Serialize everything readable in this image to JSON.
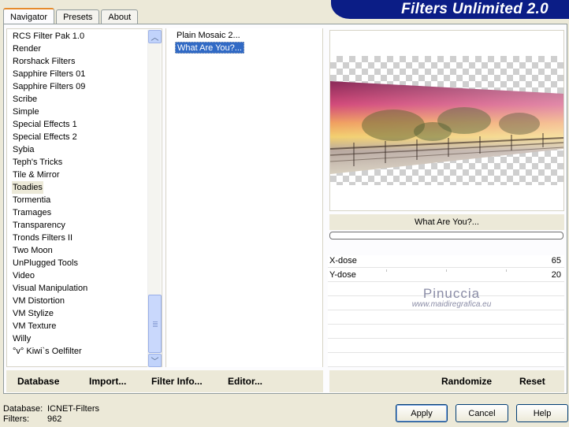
{
  "tabs": [
    "Navigator",
    "Presets",
    "About"
  ],
  "title": "Filters Unlimited 2.0",
  "categories": [
    "RCS Filter Pak 1.0",
    "Render",
    "Rorshack Filters",
    "Sapphire Filters 01",
    "Sapphire Filters 09",
    "Scribe",
    "Simple",
    "Special Effects 1",
    "Special Effects 2",
    "Sybia",
    "Teph's Tricks",
    "Tile & Mirror",
    "Toadies",
    "Tormentia",
    "Tramages",
    "Transparency",
    "Tronds Filters II",
    "Two Moon",
    "UnPlugged Tools",
    "Video",
    "Visual Manipulation",
    "VM Distortion",
    "VM Stylize",
    "VM Texture",
    "Willy",
    "°v° Kiwi`s Oelfilter"
  ],
  "selected_category": "Toadies",
  "filters": [
    "Plain Mosaic 2...",
    "What Are You?..."
  ],
  "selected_filter": "What Are You?...",
  "filter_name": "What Are You?...",
  "params": [
    {
      "label": "X-dose",
      "value": "65"
    },
    {
      "label": "Y-dose",
      "value": "20"
    }
  ],
  "watermark": {
    "name": "Pinuccia",
    "url": "www.maidiregrafica.eu"
  },
  "links": {
    "database": "Database",
    "import": "Import...",
    "filter_info": "Filter Info...",
    "editor": "Editor...",
    "randomize": "Randomize",
    "reset": "Reset"
  },
  "status": {
    "database_label": "Database:",
    "database_value": "ICNET-Filters",
    "filters_label": "Filters:",
    "filters_value": "962"
  },
  "buttons": {
    "apply": "Apply",
    "cancel": "Cancel",
    "help": "Help"
  }
}
